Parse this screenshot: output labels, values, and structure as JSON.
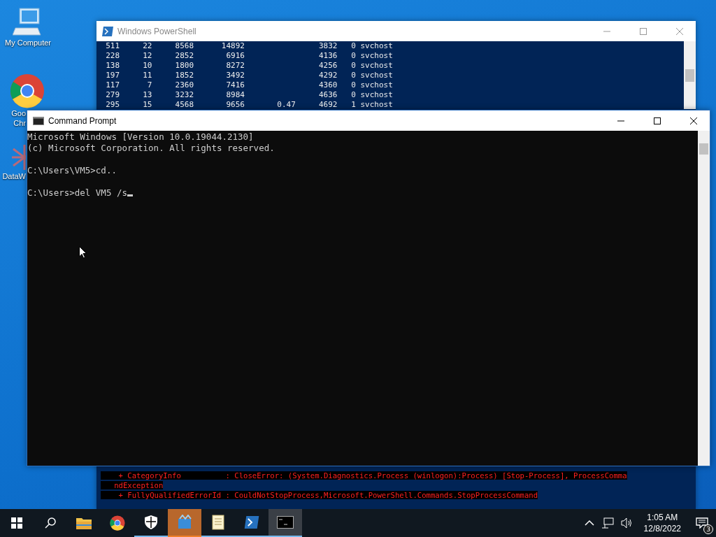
{
  "desktop_icons": [
    {
      "kind": "computer",
      "label": [
        "My Computer"
      ]
    },
    {
      "kind": "chrome",
      "label": [
        "Goo",
        "Chr"
      ]
    },
    {
      "kind": "app",
      "label": [
        "DataW"
      ]
    }
  ],
  "powershell": {
    "title": "Windows PowerShell",
    "rows": [
      [
        "511",
        "22",
        "8568",
        "14892",
        "",
        "3832",
        "0",
        "svchost"
      ],
      [
        "228",
        "12",
        "2852",
        "6916",
        "",
        "4136",
        "0",
        "svchost"
      ],
      [
        "138",
        "10",
        "1800",
        "8272",
        "",
        "4256",
        "0",
        "svchost"
      ],
      [
        "197",
        "11",
        "1852",
        "3492",
        "",
        "4292",
        "0",
        "svchost"
      ],
      [
        "117",
        "7",
        "2360",
        "7416",
        "",
        "4360",
        "0",
        "svchost"
      ],
      [
        "279",
        "13",
        "3232",
        "8984",
        "",
        "4636",
        "0",
        "svchost"
      ],
      [
        "295",
        "15",
        "4568",
        "9656",
        "0.47",
        "4692",
        "1",
        "svchost"
      ]
    ],
    "error_lines": [
      "    + CategoryInfo          : CloseError: (System.Diagnostics.Process (winlogon):Process) [Stop-Process], ProcessComma",
      "   ndException",
      "    + FullyQualifiedErrorId : CouldNotStopProcess,Microsoft.PowerShell.Commands.StopProcessCommand"
    ]
  },
  "cmd": {
    "title": "Command Prompt",
    "blocks": [
      [
        "Microsoft Windows [Version 10.0.19044.2130]",
        "(c) Microsoft Corporation. All rights reserved."
      ],
      [
        "C:\\Users\\VM5>cd.."
      ],
      [
        "C:\\Users>del VM5 /s"
      ]
    ]
  },
  "taskbar": {
    "apps": [
      {
        "kind": "folder",
        "running": false,
        "selected": false,
        "flashing": false
      },
      {
        "kind": "chrome",
        "running": false,
        "selected": false,
        "flashing": false
      },
      {
        "kind": "shield",
        "running": true,
        "selected": false,
        "flashing": false
      },
      {
        "kind": "app",
        "running": true,
        "selected": false,
        "flashing": true
      },
      {
        "kind": "notepad",
        "running": true,
        "selected": false,
        "flashing": false
      },
      {
        "kind": "powershell",
        "running": true,
        "selected": false,
        "flashing": false
      },
      {
        "kind": "cmd",
        "running": true,
        "selected": true,
        "flashing": false
      }
    ],
    "time": "1:05 AM",
    "date": "12/8/2022",
    "notifications": "3"
  }
}
